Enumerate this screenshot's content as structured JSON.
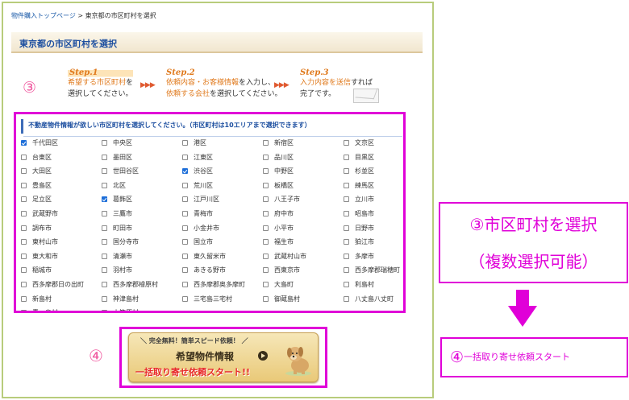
{
  "breadcrumb": {
    "home": "物件購入トップページ",
    "sep": ">",
    "current": "東京都の市区町村を選択"
  },
  "page_title": "東京都の市区町村を選択",
  "steps": {
    "step1": {
      "head": "Step.1",
      "l1a": "希望する市区町村",
      "l1b": "を",
      "l2": "選択してください。"
    },
    "arrow": "▶▶▶",
    "step2": {
      "head": "Step.2",
      "l1a": "依頼内容・お客様情報",
      "l1b": "を入力し、",
      "l2a": "依頼する会社",
      "l2b": "を選択してください。"
    },
    "step3": {
      "head": "Step.3",
      "l1a": "入力内容を送信",
      "l1b": "すれば",
      "l2": "完了です。"
    }
  },
  "marker3": "③",
  "marker4": "④",
  "selector": {
    "header": "不動産物件情報が欲しい市区町村を選択してください。（市区町村は10エリアまで選択できます）",
    "rows": [
      [
        {
          "label": "千代田区",
          "checked": true
        },
        {
          "label": "中央区",
          "checked": false
        },
        {
          "label": "港区",
          "checked": false
        },
        {
          "label": "新宿区",
          "checked": false
        },
        {
          "label": "文京区",
          "checked": false
        }
      ],
      [
        {
          "label": "台東区",
          "checked": false
        },
        {
          "label": "墨田区",
          "checked": false
        },
        {
          "label": "江東区",
          "checked": false
        },
        {
          "label": "品川区",
          "checked": false
        },
        {
          "label": "目黒区",
          "checked": false
        }
      ],
      [
        {
          "label": "大田区",
          "checked": false
        },
        {
          "label": "世田谷区",
          "checked": false
        },
        {
          "label": "渋谷区",
          "checked": true
        },
        {
          "label": "中野区",
          "checked": false
        },
        {
          "label": "杉並区",
          "checked": false
        }
      ],
      [
        {
          "label": "豊島区",
          "checked": false
        },
        {
          "label": "北区",
          "checked": false
        },
        {
          "label": "荒川区",
          "checked": false
        },
        {
          "label": "板橋区",
          "checked": false
        },
        {
          "label": "練馬区",
          "checked": false
        }
      ],
      [
        {
          "label": "足立区",
          "checked": false
        },
        {
          "label": "葛飾区",
          "checked": true
        },
        {
          "label": "江戸川区",
          "checked": false
        },
        {
          "label": "八王子市",
          "checked": false
        },
        {
          "label": "立川市",
          "checked": false
        }
      ],
      [
        {
          "label": "武蔵野市",
          "checked": false
        },
        {
          "label": "三鷹市",
          "checked": false
        },
        {
          "label": "青梅市",
          "checked": false
        },
        {
          "label": "府中市",
          "checked": false
        },
        {
          "label": "昭島市",
          "checked": false
        }
      ],
      [
        {
          "label": "調布市",
          "checked": false
        },
        {
          "label": "町田市",
          "checked": false
        },
        {
          "label": "小金井市",
          "checked": false
        },
        {
          "label": "小平市",
          "checked": false
        },
        {
          "label": "日野市",
          "checked": false
        }
      ],
      [
        {
          "label": "東村山市",
          "checked": false
        },
        {
          "label": "国分寺市",
          "checked": false
        },
        {
          "label": "国立市",
          "checked": false
        },
        {
          "label": "福生市",
          "checked": false
        },
        {
          "label": "狛江市",
          "checked": false
        }
      ],
      [
        {
          "label": "東大和市",
          "checked": false
        },
        {
          "label": "清瀬市",
          "checked": false
        },
        {
          "label": "東久留米市",
          "checked": false
        },
        {
          "label": "武蔵村山市",
          "checked": false
        },
        {
          "label": "多摩市",
          "checked": false
        }
      ],
      [
        {
          "label": "稲城市",
          "checked": false
        },
        {
          "label": "羽村市",
          "checked": false
        },
        {
          "label": "あきる野市",
          "checked": false
        },
        {
          "label": "西東京市",
          "checked": false
        },
        {
          "label": "西多摩郡瑞穂町",
          "checked": false
        }
      ],
      [
        {
          "label": "西多摩郡日の出町",
          "checked": false
        },
        {
          "label": "西多摩郡檜原村",
          "checked": false
        },
        {
          "label": "西多摩郡奥多摩町",
          "checked": false
        },
        {
          "label": "大島町",
          "checked": false
        },
        {
          "label": "利島村",
          "checked": false
        }
      ],
      [
        {
          "label": "新島村",
          "checked": false
        },
        {
          "label": "神津島村",
          "checked": false
        },
        {
          "label": "三宅島三宅村",
          "checked": false
        },
        {
          "label": "御蔵島村",
          "checked": false
        },
        {
          "label": "八丈島八丈町",
          "checked": false
        }
      ],
      [
        {
          "label": "青ヶ島村",
          "checked": false
        },
        {
          "label": "小笠原村",
          "checked": false
        }
      ]
    ]
  },
  "banner": {
    "top": "＼ 完全無料！簡単スピード依頼！ ／",
    "main": "希望物件情報",
    "sub": "一括取り寄せ依頼スタート!!"
  },
  "annotations": {
    "a3_line1": "③市区町村を選択",
    "a3_line2": "（複数選択可能）",
    "a4_num": "④",
    "a4_text": "一括取り寄せ依頼スタート"
  },
  "colors": {
    "accent_pink": "#e000d8",
    "title_blue": "#1d4fa0",
    "step_orange": "#e07a1d",
    "checkbox_blue": "#1e6fd9"
  }
}
